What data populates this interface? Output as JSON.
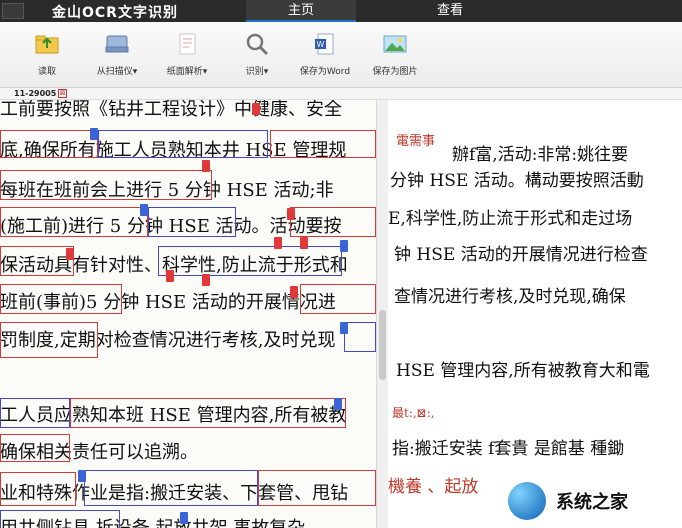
{
  "app": {
    "title": "金山OCR文字识别"
  },
  "tabs": [
    {
      "label": "主页"
    },
    {
      "label": "查看"
    }
  ],
  "toolbar": [
    {
      "label": "读取",
      "icon": "folder-open-icon"
    },
    {
      "label": "从扫描仪▾",
      "icon": "scanner-icon"
    },
    {
      "label": "纸面解析▾",
      "icon": "page-analysis-icon"
    },
    {
      "label": "识别▾",
      "icon": "magnifier-icon"
    },
    {
      "label": "保存为Word",
      "icon": "word-document-icon"
    },
    {
      "label": "保存为图片",
      "icon": "image-icon"
    }
  ],
  "document": {
    "id": "11-29005",
    "close": "⊠"
  },
  "left_lines": [
    "工前要按照《钻井工程设计》中健康、安全",
    "底,确保所有施工人员熟知本井 HSE 管理规",
    "每班在班前会上进行 5 分钟 HSE 活动;非",
    "(施工前)进行 5 分钟 HSE 活动。活动要按",
    "保活动具有针对性、科学性,防止流于形式和",
    "班前(事前)5 分钟 HSE 活动的开展情况进",
    "罚制度,定期对检查情况进行考核,及时兑现",
    "",
    "工人员应熟知本班 HSE 管理内容,所有被教",
    "确保相关责任可以追溯。",
    "业和特殊作业是指:搬迁安装、下套管、甩钻",
    "用井侧钻具 拆设备 起放井架 事故复杂"
  ],
  "right_lines": [
    {
      "text": "電需事",
      "style": "red"
    },
    {
      "text": "辦f富,活动:非常:姚往要",
      "style": ""
    },
    {
      "text": "分钟 HSE 活动。構动要按照活動",
      "style": ""
    },
    {
      "text": "E,科学性,防止流于形式和走过场",
      "style": ""
    },
    {
      "text": "钟 HSE 活动的开展情况进行检查",
      "style": ""
    },
    {
      "text": "查情况进行考核,及时兑现,确保",
      "style": ""
    },
    {
      "text": "HSE 管理内容,所有被教育大和電",
      "style": ""
    },
    {
      "text": "最t:,⊠:,",
      "style": "red small"
    },
    {
      "text": "指:搬迁安装 f套貴 是館基 種鋤",
      "style": ""
    },
    {
      "text": "機養 、起放",
      "style": "red"
    }
  ],
  "watermark": {
    "text": "系统之家"
  }
}
